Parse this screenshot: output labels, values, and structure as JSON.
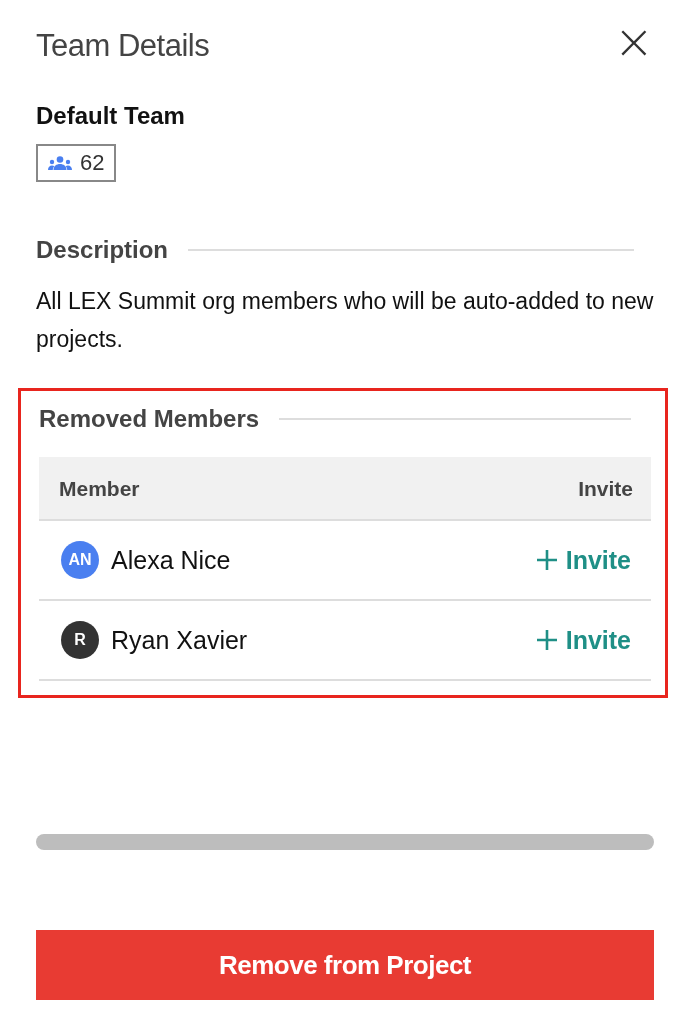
{
  "header": {
    "title": "Team Details",
    "close": "×"
  },
  "team": {
    "name": "Default Team",
    "member_count": "62"
  },
  "description": {
    "heading": "Description",
    "text": "All LEX Summit org members who will be auto-added to new projects."
  },
  "removed_members": {
    "heading": "Removed Members",
    "highlighted": true,
    "table": {
      "columns": [
        "Member",
        "Invite"
      ],
      "rows": [
        {
          "initials": "AN",
          "color": "#4a7ff0",
          "name": "Alexa Nice",
          "action": "Invite"
        },
        {
          "initials": "R",
          "color": "#333333",
          "name": "Ryan Xavier",
          "action": "Invite"
        }
      ]
    }
  },
  "footer": {
    "button": "Remove from Project"
  }
}
